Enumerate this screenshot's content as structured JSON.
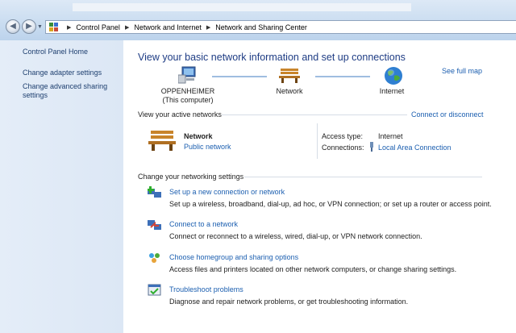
{
  "breadcrumb": [
    "Control Panel",
    "Network and Internet",
    "Network and Sharing Center"
  ],
  "left_links": [
    "Control Panel Home",
    "Change adapter settings",
    "Change advanced sharing settings"
  ],
  "main": {
    "title": "View your basic network information and set up connections",
    "see_full_map": "See full map",
    "map": {
      "computer_name": "OPPENHEIMER",
      "computer_sub": "(This computer)",
      "network": "Network",
      "internet": "Internet"
    },
    "active_networks": {
      "heading": "View your active networks",
      "connect_link": "Connect or disconnect",
      "network_name": "Network",
      "network_type": "Public network",
      "access_type_label": "Access type:",
      "access_type_value": "Internet",
      "connections_label": "Connections:",
      "connections_value": "Local Area Connection"
    },
    "settings": {
      "heading": "Change your networking settings",
      "tasks": [
        {
          "title": "Set up a new connection or network",
          "desc": "Set up a wireless, broadband, dial-up, ad hoc, or VPN connection; or set up a router or access point."
        },
        {
          "title": "Connect to a network",
          "desc": "Connect or reconnect to a wireless, wired, dial-up, or VPN network connection."
        },
        {
          "title": "Choose homegroup and sharing options",
          "desc": "Access files and printers located on other network computers, or change sharing settings."
        },
        {
          "title": "Troubleshoot problems",
          "desc": "Diagnose and repair network problems, or get troubleshooting information."
        }
      ]
    }
  },
  "colors": {
    "link": "#1c5fb0",
    "title": "#1e3c84",
    "left_pane": "#e4edf8"
  }
}
